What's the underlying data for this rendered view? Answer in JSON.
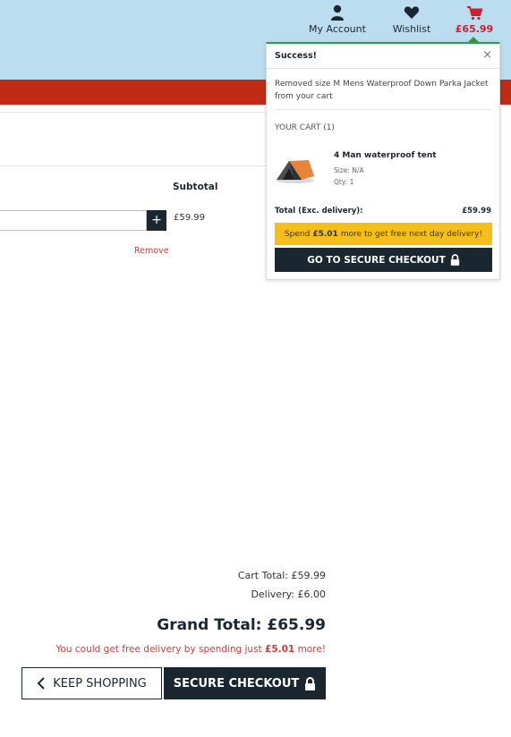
{
  "header": {
    "account_label": "My Account",
    "wishlist_label": "Wishlist",
    "cart_total": "£65.99",
    "icons": [
      "user-icon",
      "heart-icon",
      "cart-icon"
    ],
    "cart_color": "#cf2030",
    "bar_color": "#bcdcf0",
    "banner_color": "#c12a14"
  },
  "cart_table": {
    "subtotal_header": "Subtotal",
    "quantity_increment": "+",
    "line_subtotal": "£59.99",
    "remove_label": "Remove"
  },
  "totals": {
    "cart_total": "Cart Total: £59.99",
    "delivery": "Delivery: £6.00",
    "grand_total": "Grand Total: £65.99",
    "free_delivery_prefix": "You could get free delivery by spending just",
    "free_delivery_amount": "£5.01",
    "free_delivery_suffix": "more!"
  },
  "actions": {
    "keep_shopping": "KEEP SHOPPING",
    "secure_checkout": "SECURE CHECKOUT"
  },
  "popup": {
    "title": "Success!",
    "close": "×",
    "message": "Removed size M Mens Waterproof Down Parka Jacket from your cart",
    "your_cart": "YOUR CART (1)",
    "item": {
      "name": "4 Man waterproof tent",
      "size": "Size: N/A",
      "qty": "Qty: 1"
    },
    "total_label": "Total (Exc. delivery):",
    "total_value": "£59.99",
    "promo_prefix": "Spend",
    "promo_amount": "£5.01",
    "promo_suffix": "more to get free next day delivery!",
    "checkout_label": "GO TO SECURE CHECKOUT",
    "accent_color": "#2f9a4a",
    "promo_color": "#f6be1a"
  }
}
